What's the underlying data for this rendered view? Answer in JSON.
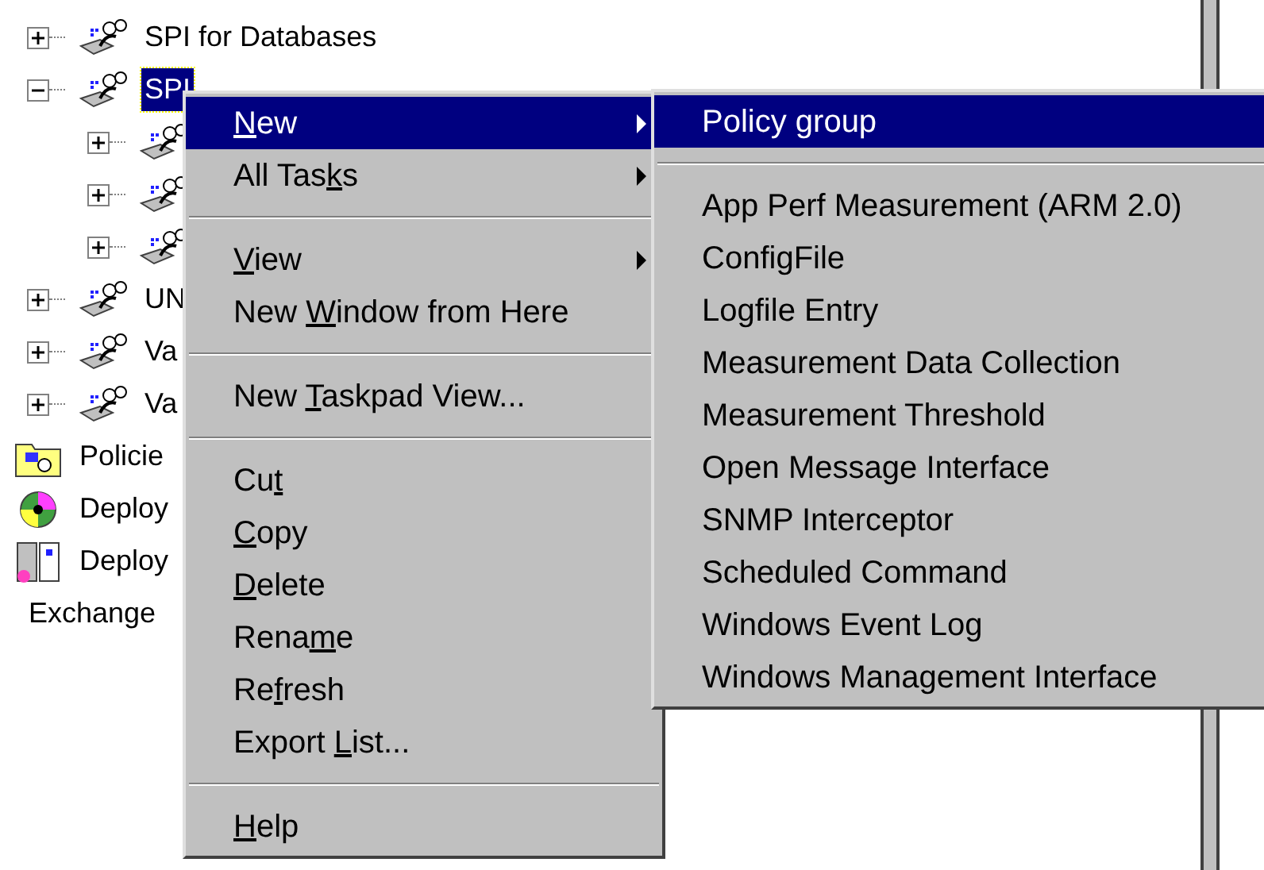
{
  "tree": {
    "items": [
      {
        "label": "SPI for Databases",
        "kind": "snapin",
        "expanded": false,
        "selected": false
      },
      {
        "label": "SPI",
        "kind": "snapin",
        "expanded": true,
        "selected": true,
        "children": [
          {
            "kind": "snapin",
            "expanded": false
          },
          {
            "kind": "snapin",
            "expanded": false
          },
          {
            "kind": "snapin",
            "expanded": false
          }
        ]
      },
      {
        "label": "UN",
        "kind": "snapin",
        "expanded": false,
        "selected": false
      },
      {
        "label": "Va",
        "kind": "snapin",
        "expanded": false,
        "selected": false
      },
      {
        "label": "Va",
        "kind": "snapin",
        "expanded": false,
        "selected": false
      },
      {
        "label": "Policie",
        "kind": "folder",
        "selected": false
      },
      {
        "label": "Deploy",
        "kind": "disc",
        "selected": false
      },
      {
        "label": "Deploy",
        "kind": "servers",
        "selected": false
      },
      {
        "label": "Exchange",
        "kind": "plain",
        "selected": false
      }
    ]
  },
  "context_menu": {
    "items": [
      {
        "kind": "item",
        "parts": [
          {
            "text": "N",
            "underline": true
          },
          {
            "text": "ew",
            "underline": false
          }
        ],
        "submenu": true,
        "selected": true
      },
      {
        "kind": "item",
        "parts": [
          {
            "text": "All Tas",
            "underline": false
          },
          {
            "text": "k",
            "underline": true
          },
          {
            "text": "s",
            "underline": false
          }
        ],
        "submenu": true,
        "selected": false
      },
      {
        "kind": "separator"
      },
      {
        "kind": "item",
        "parts": [
          {
            "text": "V",
            "underline": true
          },
          {
            "text": "iew",
            "underline": false
          }
        ],
        "submenu": true,
        "selected": false
      },
      {
        "kind": "item",
        "parts": [
          {
            "text": "New ",
            "underline": false
          },
          {
            "text": "W",
            "underline": true
          },
          {
            "text": "indow from Here",
            "underline": false
          }
        ],
        "submenu": false,
        "selected": false
      },
      {
        "kind": "separator"
      },
      {
        "kind": "item",
        "parts": [
          {
            "text": "New ",
            "underline": false
          },
          {
            "text": "T",
            "underline": true
          },
          {
            "text": "askpad View...",
            "underline": false
          }
        ],
        "submenu": false,
        "selected": false
      },
      {
        "kind": "separator"
      },
      {
        "kind": "item",
        "parts": [
          {
            "text": "Cu",
            "underline": false
          },
          {
            "text": "t",
            "underline": true
          }
        ],
        "submenu": false,
        "selected": false
      },
      {
        "kind": "item",
        "parts": [
          {
            "text": "C",
            "underline": true
          },
          {
            "text": "opy",
            "underline": false
          }
        ],
        "submenu": false,
        "selected": false
      },
      {
        "kind": "item",
        "parts": [
          {
            "text": "D",
            "underline": true
          },
          {
            "text": "elete",
            "underline": false
          }
        ],
        "submenu": false,
        "selected": false
      },
      {
        "kind": "item",
        "parts": [
          {
            "text": "Rena",
            "underline": false
          },
          {
            "text": "m",
            "underline": true
          },
          {
            "text": "e",
            "underline": false
          }
        ],
        "submenu": false,
        "selected": false
      },
      {
        "kind": "item",
        "parts": [
          {
            "text": "Re",
            "underline": false
          },
          {
            "text": "f",
            "underline": true
          },
          {
            "text": "resh",
            "underline": false
          }
        ],
        "submenu": false,
        "selected": false
      },
      {
        "kind": "item",
        "parts": [
          {
            "text": "Export ",
            "underline": false
          },
          {
            "text": "L",
            "underline": true
          },
          {
            "text": "ist...",
            "underline": false
          }
        ],
        "submenu": false,
        "selected": false
      },
      {
        "kind": "separator"
      },
      {
        "kind": "item",
        "parts": [
          {
            "text": "H",
            "underline": true
          },
          {
            "text": "elp",
            "underline": false
          }
        ],
        "submenu": false,
        "selected": false
      }
    ]
  },
  "submenu": {
    "items": [
      {
        "kind": "item",
        "parts": [
          {
            "text": "Policy group",
            "underline": false
          }
        ],
        "selected": true
      },
      {
        "kind": "separator"
      },
      {
        "kind": "item",
        "parts": [
          {
            "text": "App Perf Measurement (ARM 2.0)",
            "underline": false
          }
        ],
        "selected": false
      },
      {
        "kind": "item",
        "parts": [
          {
            "text": "ConfigFile",
            "underline": false
          }
        ],
        "selected": false
      },
      {
        "kind": "item",
        "parts": [
          {
            "text": "Logfile Entry",
            "underline": false
          }
        ],
        "selected": false
      },
      {
        "kind": "item",
        "parts": [
          {
            "text": "Measurement Data Collection",
            "underline": false
          }
        ],
        "selected": false
      },
      {
        "kind": "item",
        "parts": [
          {
            "text": "Measurement Threshold",
            "underline": false
          }
        ],
        "selected": false
      },
      {
        "kind": "item",
        "parts": [
          {
            "text": "Open Message Interface",
            "underline": false
          }
        ],
        "selected": false
      },
      {
        "kind": "item",
        "parts": [
          {
            "text": "SNMP Interceptor",
            "underline": false
          }
        ],
        "selected": false
      },
      {
        "kind": "item",
        "parts": [
          {
            "text": "Scheduled Command",
            "underline": false
          }
        ],
        "selected": false
      },
      {
        "kind": "item",
        "parts": [
          {
            "text": "Windows Event Log",
            "underline": false
          }
        ],
        "selected": false
      },
      {
        "kind": "item",
        "parts": [
          {
            "text": "Windows Management Interface",
            "underline": false
          }
        ],
        "selected": false
      }
    ]
  }
}
